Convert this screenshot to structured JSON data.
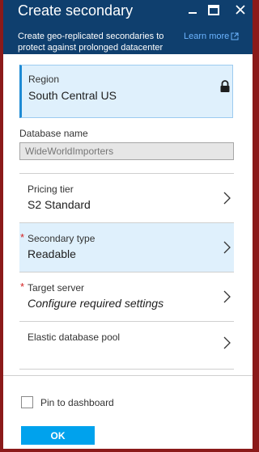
{
  "header": {
    "title": "Create secondary",
    "subtitle": "Create geo-replicated secondaries to protect against prolonged datacenter",
    "learn_more": "Learn more",
    "icons": [
      "minimize-icon",
      "maximize-icon",
      "close-icon"
    ]
  },
  "form": {
    "region": {
      "label": "Region",
      "value": "South Central US",
      "icon": "lock-icon"
    },
    "database_name": {
      "label": "Database name",
      "value": "WideWorldImporters"
    },
    "pricing_tier": {
      "label": "Pricing tier",
      "value": "S2 Standard"
    },
    "secondary_type": {
      "label": "Secondary type",
      "value": "Readable",
      "required_marker": "*"
    },
    "target_server": {
      "label": "Target server",
      "value": "Configure required settings",
      "required_marker": "*"
    },
    "elastic_pool": {
      "label": "Elastic database pool",
      "value": ""
    }
  },
  "footer": {
    "pin_label": "Pin to dashboard",
    "pin_checked": false,
    "ok_label": "OK"
  },
  "colors": {
    "header_bg": "#0f3f6e",
    "accent": "#00a2ed",
    "selected_bg": "#dff0fc",
    "required": "#d42020",
    "outer_border": "#8b1a1a"
  }
}
